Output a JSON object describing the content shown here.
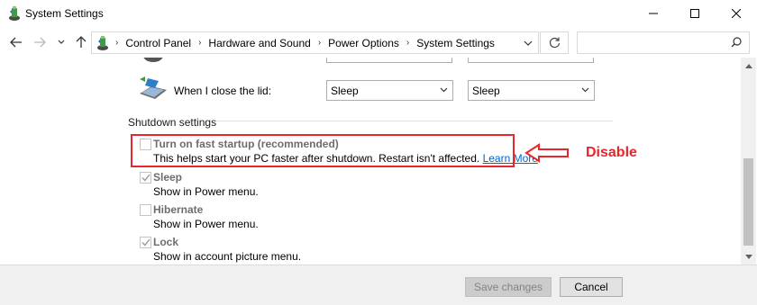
{
  "window": {
    "title": "System Settings"
  },
  "nav": {
    "breadcrumbs": [
      "Control Panel",
      "Hardware and Sound",
      "Power Options",
      "System Settings"
    ],
    "search_placeholder": ""
  },
  "lid": {
    "label": "When I close the lid:",
    "on_battery_value": "Sleep",
    "plugged_in_value": "Sleep"
  },
  "shutdown": {
    "section_title": "Shutdown settings",
    "options": [
      {
        "title": "Turn on fast startup (recommended)",
        "desc": "This helps start your PC faster after shutdown. Restart isn't affected.",
        "link": "Learn More",
        "checked": false
      },
      {
        "title": "Sleep",
        "desc": "Show in Power menu.",
        "checked": true
      },
      {
        "title": "Hibernate",
        "desc": "Show in Power menu.",
        "checked": false
      },
      {
        "title": "Lock",
        "desc": "Show in account picture menu.",
        "checked": true
      }
    ]
  },
  "annotation": {
    "text": "Disable",
    "color": "#e8262b"
  },
  "footer": {
    "save_label": "Save changes",
    "cancel_label": "Cancel"
  },
  "icons": {
    "app": "power-options-icon",
    "back": "arrow-left-icon",
    "forward": "arrow-right-icon",
    "recent": "chevron-down-icon",
    "up": "arrow-up-icon",
    "refresh": "refresh-icon",
    "search": "search-icon"
  }
}
